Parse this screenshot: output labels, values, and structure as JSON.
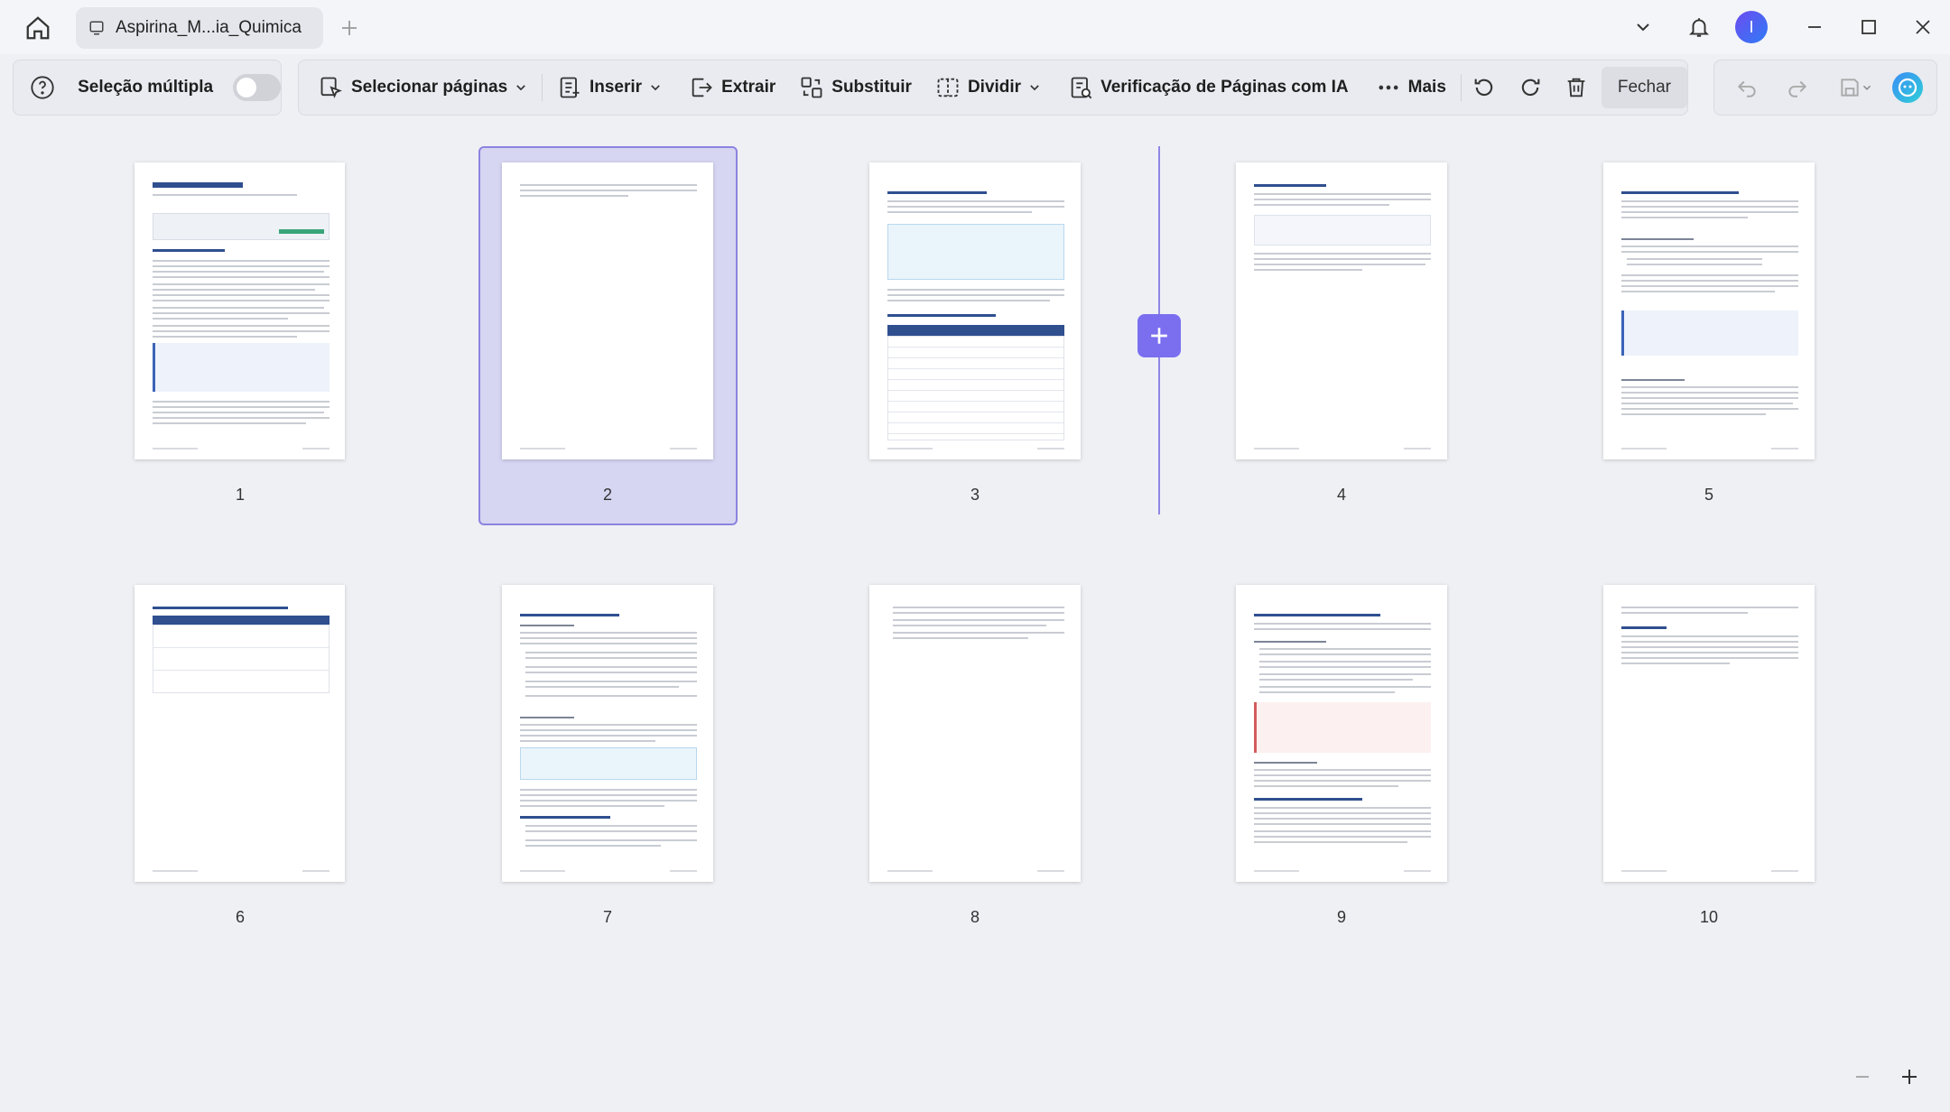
{
  "titlebar": {
    "tab_title": "Aspirina_M...ia_Quimica",
    "avatar_initial": "I"
  },
  "toolbar": {
    "multi_select_label": "Seleção múltipla",
    "select_pages_label": "Selecionar páginas",
    "insert_label": "Inserir",
    "extract_label": "Extrair",
    "replace_label": "Substituir",
    "split_label": "Dividir",
    "ai_check_label": "Verificação de Páginas com IA",
    "more_label": "Mais",
    "close_label": "Fechar"
  },
  "pages": [
    {
      "number": "1",
      "title": "Ácido Acetilsalicílico (Aspirina)"
    },
    {
      "number": "2",
      "selected": true
    },
    {
      "number": "3",
      "title": "2. Estrutura Química e Propriedades Físico-Químicas"
    },
    {
      "number": "4",
      "title": "Síntese Química em Laboratório"
    },
    {
      "number": "5",
      "title": "3. Mecanismo de Ação Bioquímica e Farmacodinâmica"
    },
    {
      "number": "6",
      "title": "Tabela 2: Comparativo das Ações Terapêuticas por Faixa Dose-Dependente"
    },
    {
      "number": "7",
      "title": "4. Farmacocinética e Aplicações Clínicas"
    },
    {
      "number": "8"
    },
    {
      "number": "9",
      "title": "6. Toxicologia, Efeitos Colaterais e Contraindicações"
    },
    {
      "number": "10",
      "title": "8. Conclusão"
    }
  ],
  "colors": {
    "accent": "#7b6ff0",
    "selection_fill": "#d6d5f2",
    "toolbar_bg": "#e9ebf0",
    "doc_heading": "#2f4f8f"
  },
  "icons": [
    "home-icon",
    "tab-doc-icon",
    "new-tab-icon",
    "chevron-down-icon",
    "bell-icon",
    "minimize-icon",
    "maximize-icon",
    "close-icon",
    "help-icon",
    "select-pages-icon",
    "insert-icon",
    "extract-icon",
    "replace-icon",
    "split-icon",
    "ai-check-icon",
    "more-icon",
    "rotate-left-icon",
    "rotate-right-icon",
    "delete-icon",
    "undo-icon",
    "redo-icon",
    "save-icon",
    "ai-assistant-icon",
    "zoom-out-icon",
    "zoom-in-icon"
  ]
}
